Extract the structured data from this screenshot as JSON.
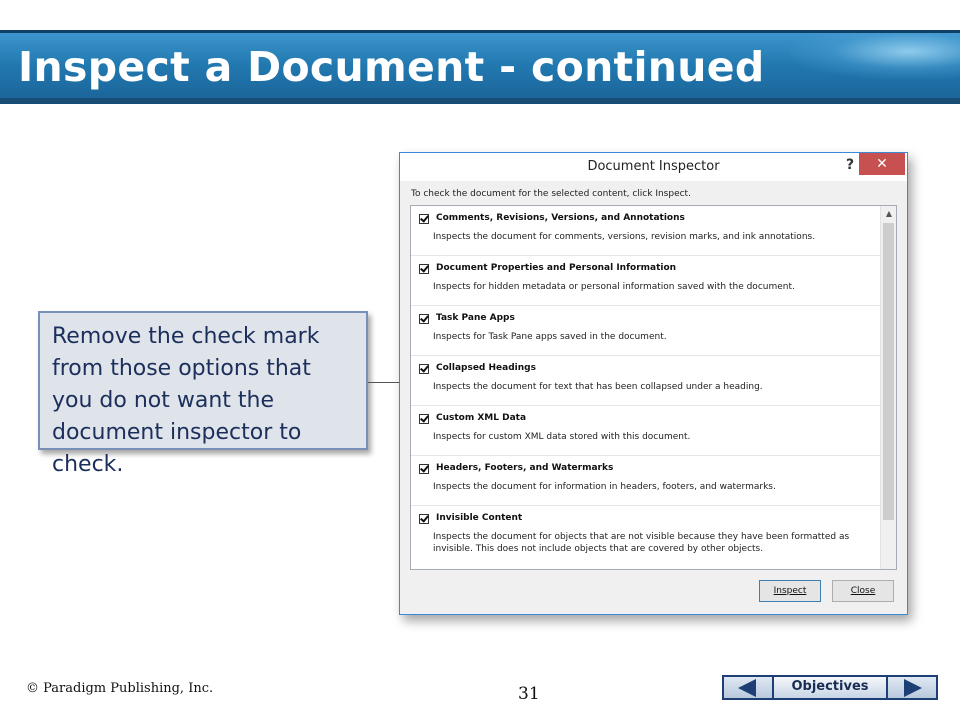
{
  "slide": {
    "title": "Inspect a Document - continued",
    "callout": "Remove the check mark from those options that you do not want the document inspector to check.",
    "footer_copyright": "© Paradigm Publishing, Inc.",
    "page_number": "31",
    "nav": {
      "label": "Objectives",
      "prev_icon": "left-arrow-icon",
      "next_icon": "right-arrow-icon"
    }
  },
  "dialog": {
    "title": "Document Inspector",
    "help_label": "?",
    "close_label": "✕",
    "prompt": "To check the document for the selected content, click Inspect.",
    "items": [
      {
        "label": "Comments, Revisions, Versions, and Annotations",
        "description": "Inspects the document for comments, versions, revision marks, and ink annotations.",
        "checked": true
      },
      {
        "label": "Document Properties and Personal Information",
        "description": "Inspects for hidden metadata or personal information saved with the document.",
        "checked": true
      },
      {
        "label": "Task Pane Apps",
        "description": "Inspects for Task Pane apps saved in the document.",
        "checked": true
      },
      {
        "label": "Collapsed Headings",
        "description": "Inspects the document for text that has been collapsed under a heading.",
        "checked": true
      },
      {
        "label": "Custom XML Data",
        "description": "Inspects for custom XML data stored with this document.",
        "checked": true
      },
      {
        "label": "Headers, Footers, and Watermarks",
        "description": "Inspects the document for information in headers, footers, and watermarks.",
        "checked": true
      },
      {
        "label": "Invisible Content",
        "description": "Inspects the document for objects that are not visible because they have been formatted as invisible. This does not include objects that are covered by other objects.",
        "checked": true
      }
    ],
    "scroll_up_icon": "▲",
    "buttons": {
      "inspect": "Inspect",
      "close": "Close"
    }
  }
}
